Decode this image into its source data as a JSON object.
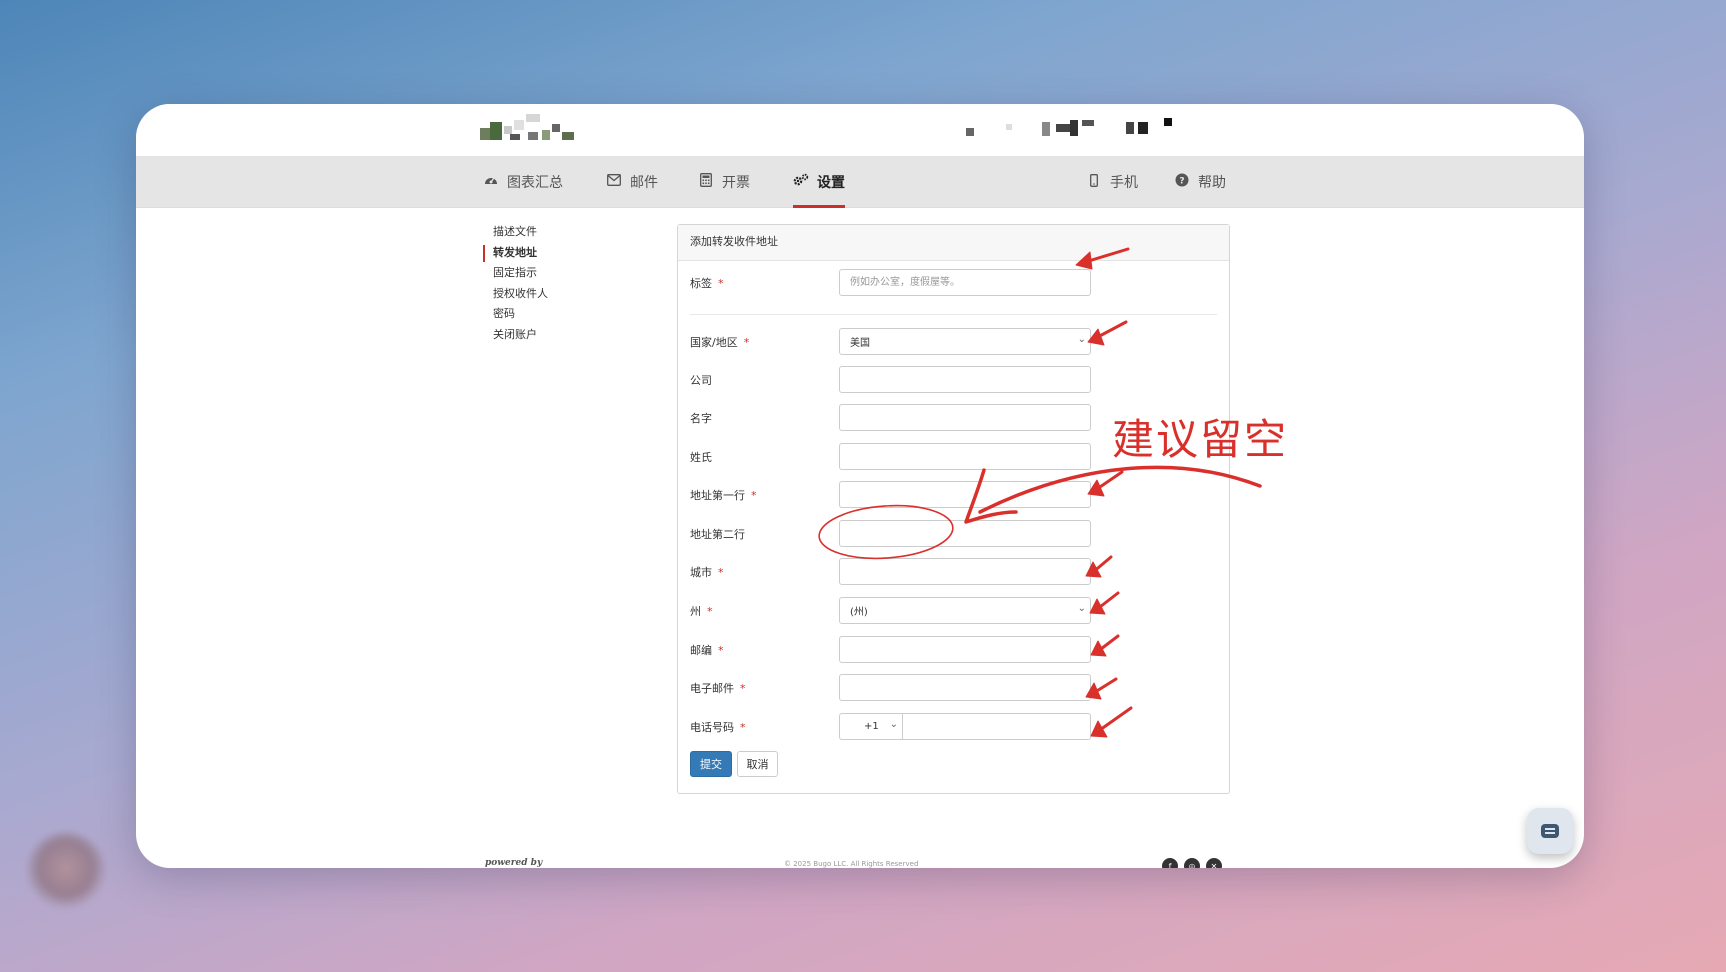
{
  "nav": {
    "items": [
      {
        "label": "图表汇总",
        "icon": "dashboard-icon"
      },
      {
        "label": "邮件",
        "icon": "envelope-icon"
      },
      {
        "label": "开票",
        "icon": "calculator-icon"
      },
      {
        "label": "设置",
        "icon": "gears-icon"
      }
    ],
    "right": [
      {
        "label": "手机",
        "icon": "mobile-icon"
      },
      {
        "label": "帮助",
        "icon": "question-circle-icon"
      }
    ]
  },
  "sidebar": {
    "items": [
      "描述文件",
      "转发地址",
      "固定指示",
      "授权收件人",
      "密码",
      "关闭账户"
    ],
    "active": "转发地址"
  },
  "form": {
    "title": "添加转发收件地址",
    "fields": {
      "label": {
        "label": "标签",
        "required": "*",
        "placeholder": "例如办公室，度假屋等。"
      },
      "country": {
        "label": "国家/地区",
        "required": "*",
        "value": "美国"
      },
      "company": {
        "label": "公司"
      },
      "first_name": {
        "label": "名字"
      },
      "last_name": {
        "label": "姓氏"
      },
      "address1": {
        "label": "地址第一行",
        "required": "*"
      },
      "address2": {
        "label": "地址第二行"
      },
      "city": {
        "label": "城市",
        "required": "*"
      },
      "state": {
        "label": "州",
        "required": "*",
        "value": "(州)"
      },
      "zip": {
        "label": "邮编",
        "required": "*"
      },
      "email": {
        "label": "电子邮件",
        "required": "*"
      },
      "phone": {
        "label": "电话号码",
        "required": "*",
        "code": "+1"
      }
    },
    "submit": "提交",
    "cancel": "取消"
  },
  "footer": {
    "powered": "powered by",
    "copyright": "© 2025 Bugo LLC. All Rights Reserved"
  },
  "annotation": {
    "text": "建议留空",
    "color": "#d9302c"
  },
  "colors": {
    "accent": "#c9302c",
    "primary_button": "#337ab7"
  }
}
